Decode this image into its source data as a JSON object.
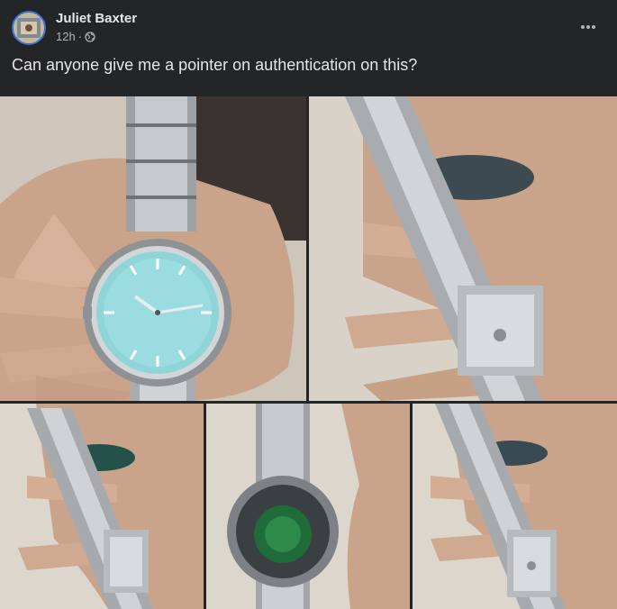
{
  "post": {
    "author": "Juliet Baxter",
    "time": "12h",
    "separator": "·",
    "privacy_icon": "globe-icon",
    "more_icon": "more-horizontal-icon",
    "caption": "Can anyone give me a pointer on authentication on this?"
  },
  "photos": [
    {
      "subject": "watch-dial-front"
    },
    {
      "subject": "bracelet-clasp-open"
    },
    {
      "subject": "clasp-side-view"
    },
    {
      "subject": "caseback-view"
    },
    {
      "subject": "clasp-detail"
    }
  ],
  "colors": {
    "background": "#242526",
    "text_primary": "#e4e6eb",
    "text_secondary": "#b0b3b8",
    "dial_color": "#8fd5d8"
  }
}
